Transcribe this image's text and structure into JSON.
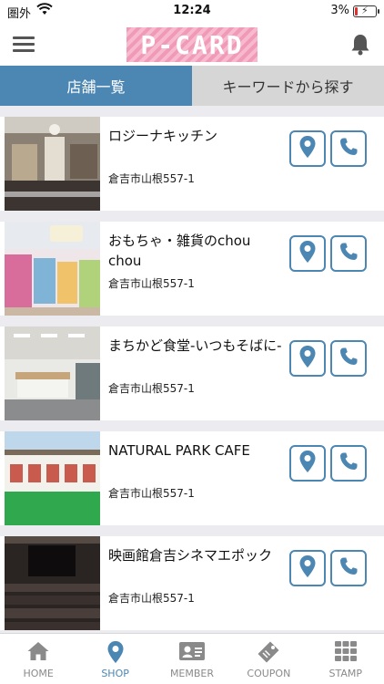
{
  "status": {
    "carrier": "圏外",
    "time": "12:24",
    "battery": "3%"
  },
  "header": {
    "logo": "P-CARD",
    "menu_icon": "hamburger-icon",
    "bell_icon": "bell-icon"
  },
  "tabs": [
    {
      "label": "店舗一覧",
      "active": true
    },
    {
      "label": "キーワードから探す",
      "active": false
    }
  ],
  "shops": [
    {
      "name": "ロジーナキッチン",
      "address": "倉吉市山根557-1"
    },
    {
      "name": "おもちゃ・雑貨のchou chou",
      "address": "倉吉市山根557-1"
    },
    {
      "name": "まちかど食堂-いつもそばに-",
      "address": "倉吉市山根557-1"
    },
    {
      "name": "NATURAL PARK CAFE",
      "address": "倉吉市山根557-1"
    },
    {
      "name": "映画館倉吉シネマエポック",
      "address": "倉吉市山根557-1"
    }
  ],
  "tabbar": [
    {
      "label": "HOME",
      "icon": "home-icon",
      "active": false
    },
    {
      "label": "SHOP",
      "icon": "map-pin-icon",
      "active": true
    },
    {
      "label": "MEMBER",
      "icon": "member-card-icon",
      "active": false
    },
    {
      "label": "COUPON",
      "icon": "coupon-icon",
      "active": false
    },
    {
      "label": "STAMP",
      "icon": "stamp-grid-icon",
      "active": false
    }
  ],
  "colors": {
    "accent": "#4c86b3",
    "logo_pink": "#f19ab8",
    "inactive_tab": "#d6d6d6"
  }
}
